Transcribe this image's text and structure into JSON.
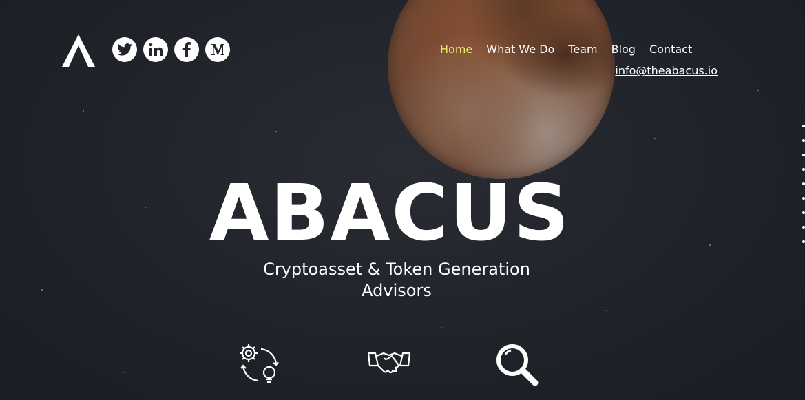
{
  "header": {
    "logo_icon": "abacus-a-logo",
    "socials": [
      {
        "icon": "twitter-icon"
      },
      {
        "icon": "linkedin-icon"
      },
      {
        "icon": "facebook-icon"
      },
      {
        "icon": "medium-icon"
      }
    ],
    "nav": [
      {
        "label": "Home",
        "active": true
      },
      {
        "label": "What We Do"
      },
      {
        "label": "Team"
      },
      {
        "label": "Blog"
      },
      {
        "label": "Contact"
      }
    ],
    "email": "info@theabacus.io"
  },
  "hero": {
    "brand": "ABACUS",
    "tagline_line1": "Cryptoasset & Token Generation",
    "tagline_line2": "Advisors"
  },
  "features": [
    {
      "icon": "gear-process-icon"
    },
    {
      "icon": "handshake-icon"
    },
    {
      "icon": "magnifier-icon"
    }
  ],
  "colors": {
    "background": "#23252d",
    "nav_active": "#e9e66a",
    "text": "#ffffff"
  }
}
